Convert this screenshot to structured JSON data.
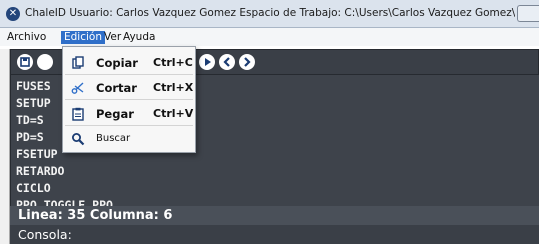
{
  "window": {
    "title": "ChaleID    Usuario: Carlos Vazquez Gomez  Espacio de Trabajo: C:\\Users\\Carlos Vazquez Gomez\\Documents\\Mapic..."
  },
  "menubar": {
    "items": [
      {
        "label": "Archivo"
      },
      {
        "label": "Edición"
      },
      {
        "label": "Ver"
      },
      {
        "label": "Ayuda"
      }
    ]
  },
  "toolbar": {
    "buttons": [
      {
        "icon": "save-icon"
      },
      {
        "icon": "play-icon"
      },
      {
        "icon": "back-icon"
      },
      {
        "icon": "forward-icon"
      }
    ]
  },
  "editor": {
    "lines": [
      "FUSES",
      "SETUP",
      "TD=S",
      "PD=S",
      "FSETUP",
      "RETARDO",
      "CICLO",
      "PPO_TOGGLE_PPO"
    ]
  },
  "status": {
    "position": "Linea: 35 Columna: 6"
  },
  "console": {
    "label": "Consola:"
  },
  "edit_menu": {
    "items": [
      {
        "label": "Copiar",
        "shortcut": "Ctrl+C",
        "icon": "copy-icon"
      },
      {
        "label": "Cortar",
        "shortcut": "Ctrl+X",
        "icon": "scissors-icon"
      },
      {
        "label": "Pegar",
        "shortcut": "Ctrl+V",
        "icon": "paste-icon"
      },
      {
        "label": "Buscar",
        "shortcut": "",
        "icon": "search-icon"
      }
    ]
  },
  "colors": {
    "editor_bg": "#3e434b",
    "menu_highlight": "#2f6fc9",
    "icon_blue": "#1b3c73"
  }
}
